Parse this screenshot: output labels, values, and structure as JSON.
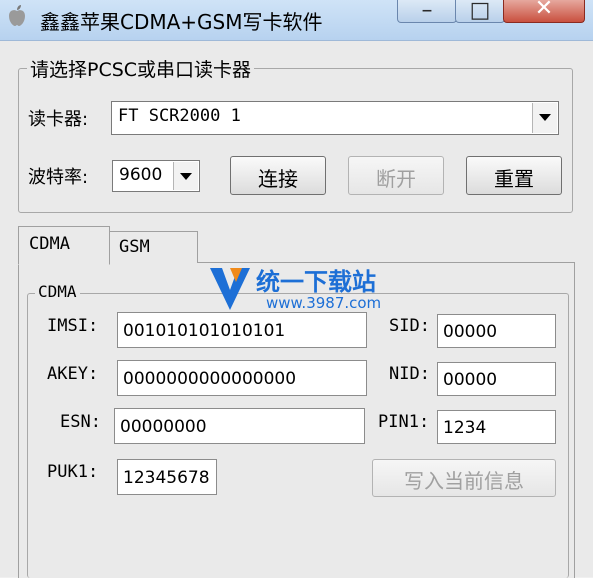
{
  "window": {
    "title": "鑫鑫苹果CDMA+GSM写卡软件"
  },
  "reader_group": {
    "legend": "请选择PCSC或串口读卡器",
    "reader_label": "读卡器:",
    "reader_value": "FT SCR2000 1",
    "baud_label": "波特率:",
    "baud_value": "9600",
    "connect_button": "连接",
    "disconnect_button": "断开",
    "reset_button": "重置"
  },
  "tabs": [
    {
      "label": "CDMA",
      "active": true
    },
    {
      "label": "GSM",
      "active": false
    }
  ],
  "cdma": {
    "legend": "CDMA",
    "imsi_label": "IMSI:",
    "imsi_value": "001010101010101",
    "akey_label": "AKEY:",
    "akey_value": "0000000000000000",
    "esn_label": "ESN:",
    "esn_value": "00000000",
    "puk1_label": "PUK1:",
    "puk1_value": "12345678",
    "sid_label": "SID:",
    "sid_value": "00000",
    "nid_label": "NID:",
    "nid_value": "00000",
    "pin1_label": "PIN1:",
    "pin1_value": "1234",
    "write_button": "写入当前信息"
  },
  "watermark": {
    "name": "统一下载站",
    "site": "www.3987.com"
  }
}
